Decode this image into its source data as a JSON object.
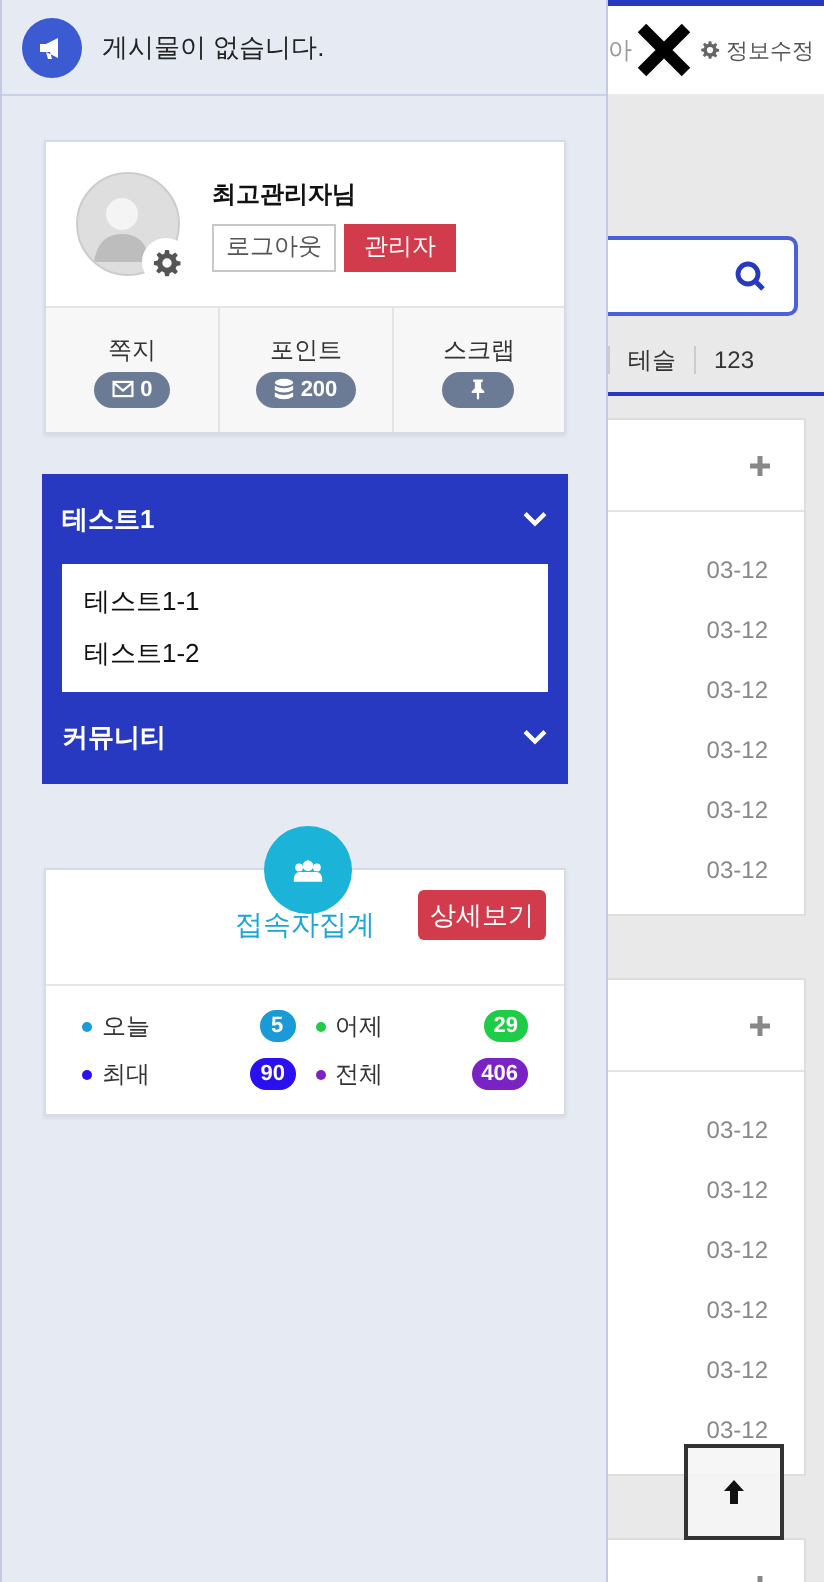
{
  "notice": {
    "text": "게시물이 없습니다."
  },
  "profile": {
    "name": "최고관리자님",
    "buttons": [
      {
        "label": "로그아웃",
        "kind": "outline"
      },
      {
        "label": "관리자",
        "kind": "primary"
      }
    ],
    "stats": [
      {
        "label": "쪽지",
        "value": "0",
        "kind": "memo"
      },
      {
        "label": "포인트",
        "value": "200",
        "kind": "point"
      },
      {
        "label": "스크랩",
        "kind": "scrap"
      }
    ]
  },
  "menu": [
    {
      "label": "테스트1",
      "children": [
        {
          "label": "테스트1-1"
        },
        {
          "label": "테스트1-2"
        }
      ]
    },
    {
      "label": "커뮤니티"
    }
  ],
  "visitors": {
    "title": "접속자집계",
    "button": "상세보기",
    "stats": [
      {
        "label": "오늘",
        "value": "5",
        "color": "#1a9ad6"
      },
      {
        "label": "어제",
        "value": "29",
        "color": "#1fcc46"
      },
      {
        "label": "최대",
        "value": "90",
        "color": "#2a0ff0"
      },
      {
        "label": "전체",
        "value": "406",
        "color": "#7b22c4"
      }
    ]
  },
  "background": {
    "top_bar": {
      "text": "아",
      "link": "정보수정"
    },
    "tabs": [
      "테슬",
      "123"
    ],
    "panels": [
      {
        "kind": "list",
        "dates": [
          "03-12",
          "03-12",
          "03-12",
          "03-12",
          "03-12",
          "03-12"
        ]
      },
      {
        "kind": "list",
        "dates": [
          "03-12",
          "03-12",
          "03-12",
          "03-12",
          "03-12",
          "03-12"
        ]
      },
      {
        "kind": "header"
      }
    ]
  }
}
